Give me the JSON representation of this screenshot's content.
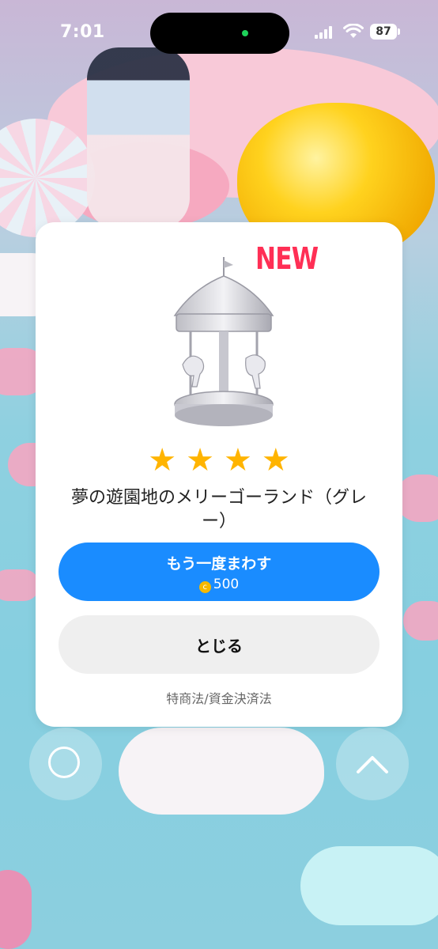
{
  "status_bar": {
    "time": "7:01",
    "battery": "87"
  },
  "modal": {
    "badge": "NEW",
    "rating_stars": 4,
    "star_glyph": "★",
    "item_name": "夢の遊園地のメリーゴーランド（グレー）",
    "spin_button": {
      "label": "もう一度まわす",
      "coin_icon": "coin-icon",
      "coin_glyph": "c",
      "cost": "500"
    },
    "close_button": {
      "label": "とじる"
    },
    "legal_link": "特商法/資金決済法"
  },
  "controls": {
    "left": "circle-icon",
    "right": "chevron-up-icon"
  },
  "colors": {
    "primary_button": "#1a8cff",
    "new_badge": "#ff2f55",
    "star": "#ffb400",
    "coin": "#f5b800"
  }
}
